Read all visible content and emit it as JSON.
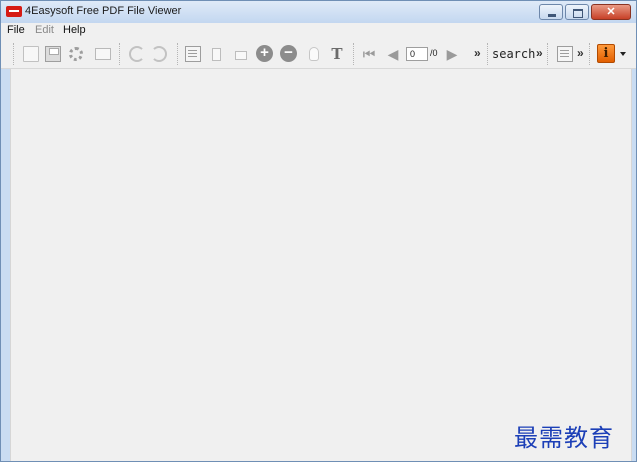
{
  "window": {
    "title": "4Easysoft Free PDF File Viewer",
    "icon": "pdf-app-icon",
    "controls": [
      "minimize-icon",
      "maximize-icon",
      "close-icon"
    ]
  },
  "menu": {
    "items": [
      {
        "label": "File",
        "enabled": true
      },
      {
        "label": "Edit",
        "enabled": false
      },
      {
        "label": "Help",
        "enabled": true
      }
    ]
  },
  "toolbar": {
    "icons": [
      "open-icon",
      "save-icon",
      "settings-icon",
      "email-icon",
      "rotate-left-icon",
      "rotate-right-icon",
      "actual-size-icon",
      "fit-page-icon",
      "fit-width-icon",
      "zoom-in-icon",
      "zoom-out-icon",
      "hand-tool-icon",
      "text-select-icon",
      "first-page-icon",
      "previous-page-icon",
      "next-page-icon",
      "properties-icon",
      "about-icon"
    ],
    "page_current": "0",
    "page_total": "/0",
    "overflow_label": "»",
    "search_label": "search"
  },
  "watermark": "最需教育",
  "colors": {
    "titlebar": "#c9dcf2",
    "close_button": "#c74027",
    "workspace": "#f0f0f0",
    "watermark": "#1c3fb7",
    "about_icon": "#f07a17"
  }
}
